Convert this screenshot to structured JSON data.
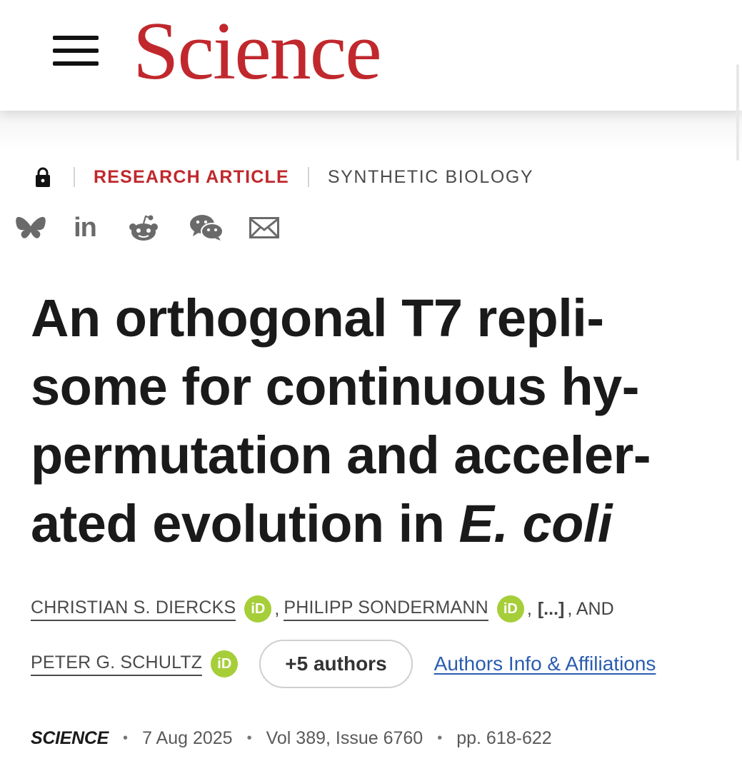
{
  "header": {
    "logo_text": "Science",
    "logo_color": "#c0282d"
  },
  "article": {
    "locked": true,
    "type_label": "RESEARCH ARTICLE",
    "topic_label": "SYNTHETIC BIOLOGY",
    "share_icons": [
      "bluesky-icon",
      "linkedin-icon",
      "reddit-icon",
      "wechat-icon",
      "email-icon"
    ],
    "linkedin_text": "in",
    "title_lines": [
      "An orthogonal T7 repli-",
      "some for continuous hy-",
      "permutation and acceler-",
      "ated evolution in "
    ],
    "title_italic": "E. coli",
    "authors": [
      {
        "name": "CHRISTIAN S. DIERCKS",
        "orcid_badge": "iD"
      },
      {
        "name": "PHILIPP SONDERMANN",
        "orcid_badge": "iD"
      },
      {
        "name": "PETER G. SCHULTZ",
        "orcid_badge": "iD"
      }
    ],
    "comma": ",",
    "ellipsis": "[...]",
    "and_text": ", AND",
    "more_authors_label": "+5 authors",
    "affiliations_link": "Authors Info & Affiliations",
    "citation": {
      "journal": "SCIENCE",
      "date": "7 Aug 2025",
      "volume_issue": "Vol 389, Issue 6760",
      "pages": "pp. 618-622",
      "separator": "•"
    }
  }
}
